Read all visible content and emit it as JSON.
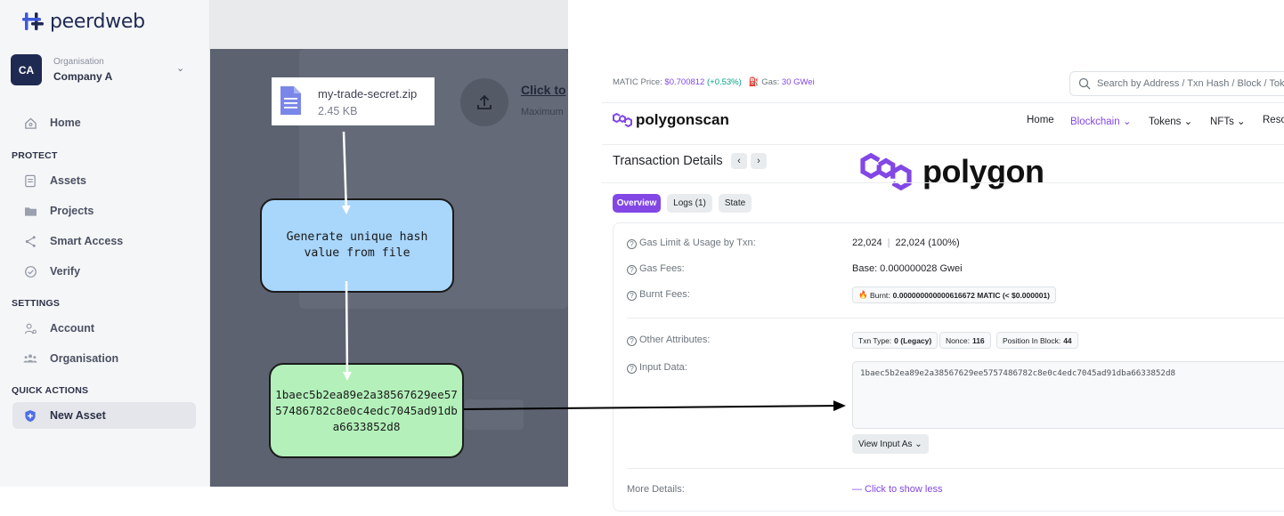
{
  "peerdweb": {
    "brand": "peerdweb",
    "organisation": {
      "caption": "Organisation",
      "name": "Company A",
      "avatar": "CA"
    },
    "nav_home": "Home",
    "sections": {
      "protect": "PROTECT",
      "settings": "SETTINGS",
      "quick_actions": "QUICK ACTIONS"
    },
    "protect_items": [
      "Assets",
      "Projects",
      "Smart Access",
      "Verify"
    ],
    "settings_items": [
      "Account",
      "Organisation"
    ],
    "quick_items": [
      "New Asset"
    ],
    "upload": {
      "click_text": "Click to",
      "max_text": "Maximum"
    },
    "icons": [
      "home-icon",
      "document-icon",
      "folder-icon",
      "share-icon",
      "check-circle-icon",
      "user-icon",
      "people-icon",
      "shield-icon",
      "upload-icon",
      "chevron-down-icon"
    ]
  },
  "diagram": {
    "file": {
      "name": "my-trade-secret.zip",
      "size": "2.45 KB"
    },
    "step_generate": "Generate unique hash value from file",
    "hash_value": "1baec5b2ea89e2a38567629ee5757486782c8e0c4edc7045ad91dba6633852d8",
    "colors": {
      "generate_box": "#a9d6fb",
      "hash_box": "#b3f0ba",
      "arrow_light": "#ffffff",
      "arrow_dark": "#000000"
    }
  },
  "polygonscan": {
    "matic_price_label": "MATIC Price:",
    "matic_price_value": "$0.700812",
    "matic_price_change": "(+0.53%)",
    "gas_label": "Gas:",
    "gas_value": "30 GWei",
    "search_placeholder": "Search by Address / Txn Hash / Block / Token",
    "brand": "polygonscan",
    "nav": [
      "Home",
      "Blockchain",
      "Tokens",
      "NFTs",
      "Reso"
    ],
    "page_title": "Transaction Details",
    "overlay_brand": "polygon",
    "tabs": [
      "Overview",
      "Logs (1)",
      "State"
    ],
    "rows": {
      "gas_limit_label": "Gas Limit & Usage by Txn:",
      "gas_limit_value": "22,024",
      "gas_usage_value": "22,024 (100%)",
      "gas_fees_label": "Gas Fees:",
      "gas_fees_value": "Base: 0.000000028 Gwei",
      "burnt_label": "Burnt Fees:",
      "burnt_prefix": "Burnt:",
      "burnt_value": "0.000000000000616672 MATIC (< $0.000001)",
      "other_label": "Other Attributes:",
      "txn_type_label": "Txn Type:",
      "txn_type_value": "0 (Legacy)",
      "nonce_label": "Nonce:",
      "nonce_value": "116",
      "position_label": "Position In Block:",
      "position_value": "44",
      "input_label": "Input Data:",
      "input_value": "1baec5b2ea89e2a38567629ee5757486782c8e0c4edc7045ad91dba6633852d8",
      "view_input": "View Input As",
      "more_label": "More Details:",
      "more_link": "— Click to show less"
    },
    "colors": {
      "accent": "#8247e5",
      "up": "#00a186"
    }
  }
}
